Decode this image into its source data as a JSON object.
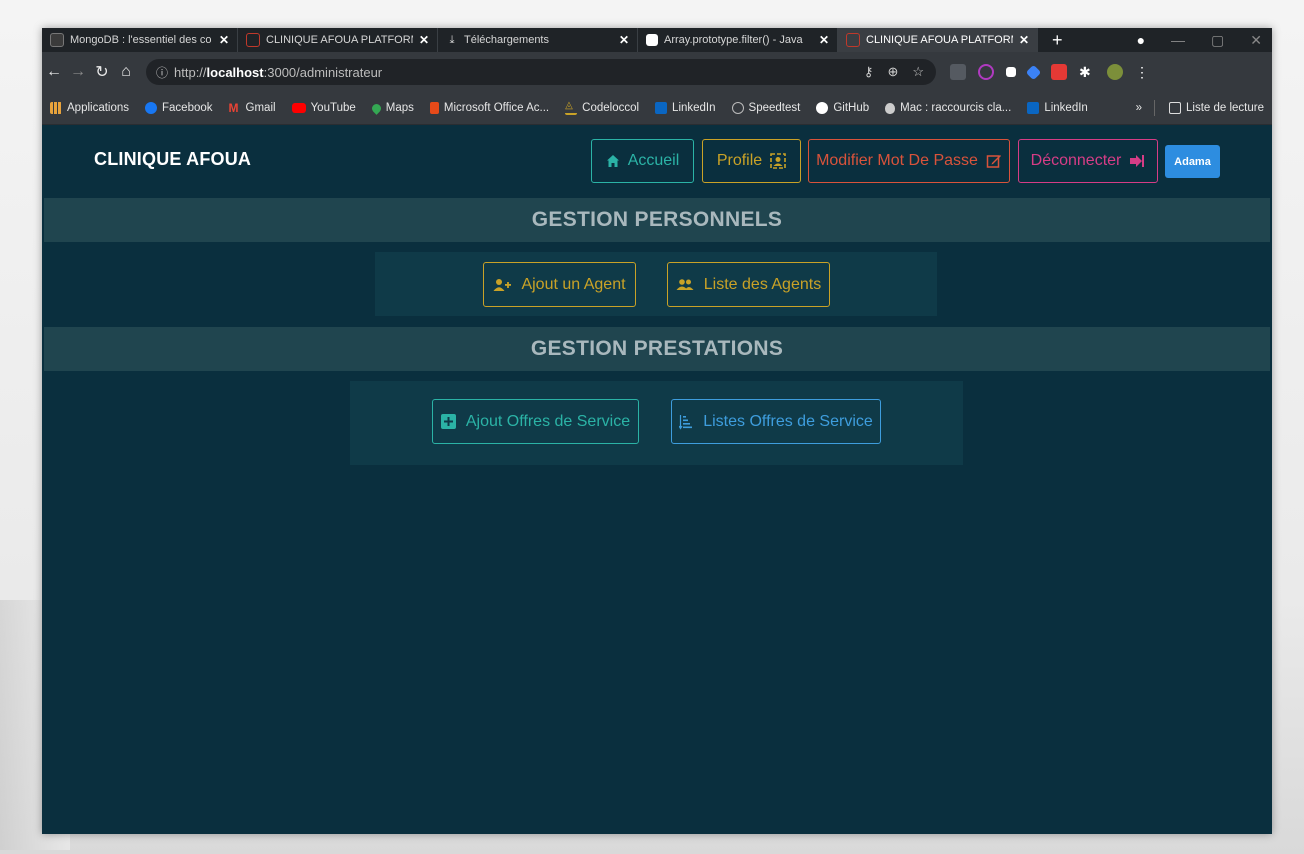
{
  "browser": {
    "tabs": [
      {
        "label": "MongoDB : l'essentiel des co",
        "icon": "mongodb-leaf-icon",
        "active": false
      },
      {
        "label": "CLINIQUE AFOUA PLATFORM",
        "icon": "react-icon",
        "active": false
      },
      {
        "label": "Téléchargements",
        "icon": "download-icon",
        "active": false
      },
      {
        "label": "Array.prototype.filter() - Java",
        "icon": "mdn-icon",
        "active": false
      },
      {
        "label": "CLINIQUE AFOUA PLATFORM",
        "icon": "react-icon",
        "active": true
      }
    ],
    "new_tab": "+",
    "url_prefix": "http://",
    "url_host": "localhost",
    "url_path": ":3000/administrateur",
    "bookmarks": [
      {
        "label": "Applications",
        "icon": "apps-grid-icon",
        "color": "#e8a33c"
      },
      {
        "label": "Facebook",
        "icon": "facebook-icon",
        "color": "#1877f2"
      },
      {
        "label": "Gmail",
        "icon": "gmail-icon",
        "color": "#ea4335"
      },
      {
        "label": "YouTube",
        "icon": "youtube-icon",
        "color": "#ff0000"
      },
      {
        "label": "Maps",
        "icon": "maps-pin-icon",
        "color": "#34a853"
      },
      {
        "label": "Microsoft Office Ac...",
        "icon": "office-icon",
        "color": "#e64a19"
      },
      {
        "label": "Codeloccol",
        "icon": "codeloccol-icon",
        "color": "#c9a227"
      },
      {
        "label": "LinkedIn",
        "icon": "linkedin-icon",
        "color": "#0a66c2"
      },
      {
        "label": "Speedtest",
        "icon": "speedtest-icon",
        "color": "#bbbbbb"
      },
      {
        "label": "GitHub",
        "icon": "github-icon",
        "color": "#ffffff"
      },
      {
        "label": "Mac : raccourcis cla...",
        "icon": "apple-icon",
        "color": "#cccccc"
      },
      {
        "label": "LinkedIn",
        "icon": "linkedin-icon",
        "color": "#0a66c2"
      }
    ],
    "bookmarks_more": "»",
    "reading_list": "Liste de lecture"
  },
  "navbar": {
    "brand": "CLINIQUE AFOUA",
    "accueil": "Accueil",
    "profile": "Profile",
    "modifier_mdp": "Modifier Mot De Passe",
    "deconnecter": "Déconnecter",
    "user": "Adama"
  },
  "sections": {
    "personnels": {
      "title": "GESTION PERSONNELS",
      "add_label": "Ajout un Agent",
      "list_label": "Liste des Agents"
    },
    "prestations": {
      "title": "GESTION PRESTATIONS",
      "add_label": "Ajout Offres de Service",
      "list_label": "Listes Offres de Service"
    }
  },
  "colors": {
    "background": "#0a2f3e",
    "teal": "#2bb3a6",
    "gold": "#c9a227",
    "orange": "#d9533b",
    "pink": "#d63d86",
    "blue": "#2d8de0"
  }
}
